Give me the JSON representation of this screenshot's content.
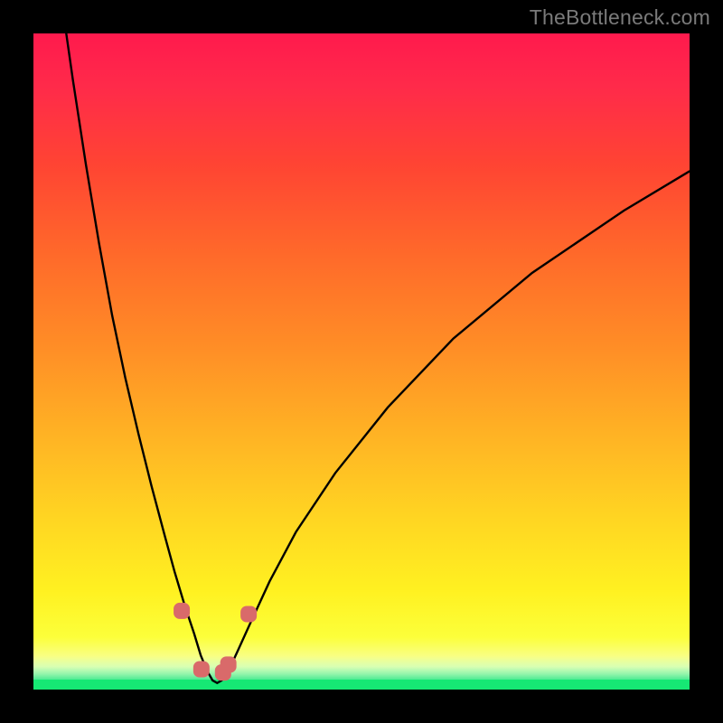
{
  "watermark": "TheBottleneck.com",
  "chart_data": {
    "type": "line",
    "title": "",
    "xlabel": "",
    "ylabel": "",
    "xlim": [
      0,
      100
    ],
    "ylim": [
      0,
      100
    ],
    "background_gradient": {
      "top": "#ff1a4d",
      "mid": "#ffb524",
      "bottom_yellow": "#fcff3a",
      "green": "#16e874"
    },
    "series": [
      {
        "name": "bottleneck-curve",
        "x": [
          5,
          6,
          8,
          10,
          12,
          14,
          16,
          18,
          20,
          21.5,
          23,
          24.5,
          25.5,
          26.5,
          27.3,
          28,
          28.7,
          29.7,
          31,
          33,
          36,
          40,
          46,
          54,
          64,
          76,
          90,
          100
        ],
        "y": [
          100,
          93,
          80,
          68,
          57,
          47.5,
          39,
          31,
          23.5,
          18,
          13,
          8.5,
          5.2,
          2.8,
          1.4,
          1.0,
          1.4,
          2.8,
          5.6,
          10,
          16.5,
          24,
          33,
          43,
          53.5,
          63.5,
          73,
          79
        ]
      }
    ],
    "markers": [
      {
        "name": "left-upper",
        "x": 22.6,
        "y": 12.0
      },
      {
        "name": "left-lower",
        "x": 25.6,
        "y": 3.1
      },
      {
        "name": "right-lower-a",
        "x": 28.9,
        "y": 2.6
      },
      {
        "name": "right-lower-b",
        "x": 29.7,
        "y": 3.8
      },
      {
        "name": "right-upper",
        "x": 32.8,
        "y": 11.5
      }
    ],
    "marker_color": "#d96a6a",
    "marker_radius_px": 9
  }
}
